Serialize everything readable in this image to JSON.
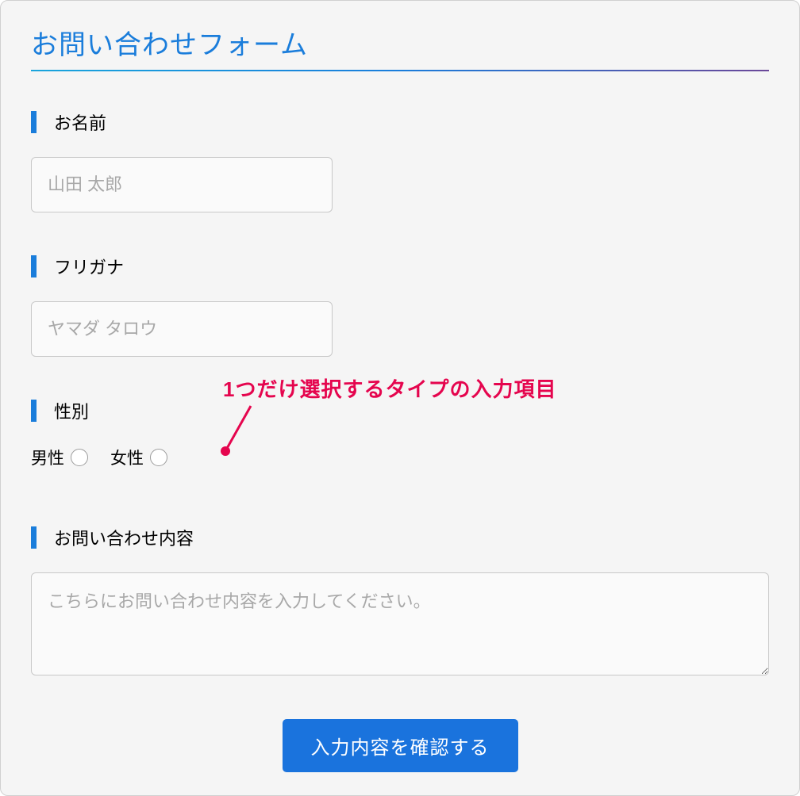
{
  "form": {
    "title": "お問い合わせフォーム",
    "fields": {
      "name": {
        "label": "お名前",
        "placeholder": "山田 太郎",
        "value": ""
      },
      "furigana": {
        "label": "フリガナ",
        "placeholder": "ヤマダ タロウ",
        "value": ""
      },
      "gender": {
        "label": "性別",
        "options": {
          "male": "男性",
          "female": "女性"
        }
      },
      "inquiry": {
        "label": "お問い合わせ内容",
        "placeholder": "こちらにお問い合わせ内容を入力してください。",
        "value": ""
      }
    },
    "submit_label": "入力内容を確認する"
  },
  "annotation": {
    "text": "1つだけ選択するタイプの入力項目"
  },
  "colors": {
    "accent": "#1a7ddb",
    "annotation": "#e5054e",
    "submit": "#1a73dd"
  }
}
